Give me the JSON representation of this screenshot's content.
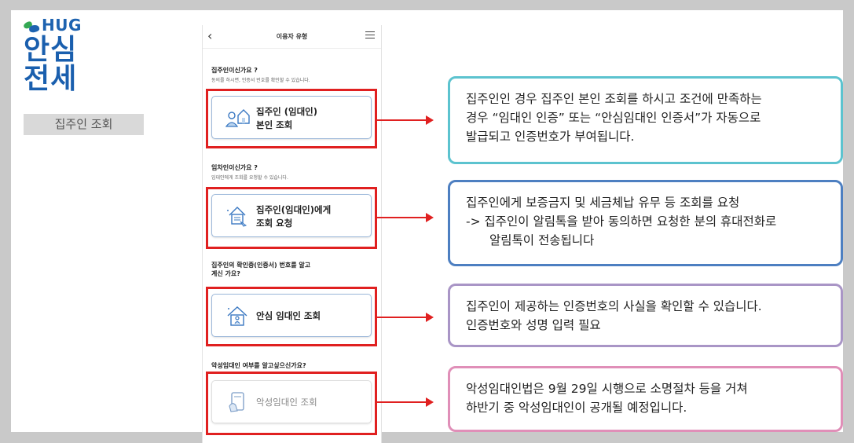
{
  "brand": {
    "logo_text": "HUG",
    "title_line1": "안심",
    "title_line2": "전세",
    "page_label": "집주인 조회"
  },
  "phone": {
    "header_title": "이용자 유형",
    "sections": [
      {
        "question": "집주인이신가요 ?",
        "sub": "동의를 하시면, 인증서 번호를 확인할 수 있습니다.",
        "card_line1": "집주인 (임대인)",
        "card_line2": "본인 조회",
        "icon": "house-person-icon"
      },
      {
        "question": "임차인이신가요 ?",
        "sub": "임대인에게 조회를 요청할 수 있습니다.",
        "card_line1": "집주인(임대인)에게",
        "card_line2": "조회 요청",
        "icon": "house-request-icon"
      },
      {
        "question_line1": "집주인의 확인증(인증서) 번호를 알고",
        "question_line2": "계신 가요?",
        "card_line1": "안심 임대인 조회",
        "icon": "house-safe-icon"
      },
      {
        "question": "악성임대인 여부를 알고싶으신가요?",
        "card_line1": "악성임대인 조회",
        "icon": "document-check-icon"
      }
    ]
  },
  "notes": [
    {
      "lines": [
        "집주인인 경우 집주인 본인 조회를 하시고 조건에 만족하는",
        "경우 “임대인 인증” 또는 “안심임대인 인증서”가 자동으로",
        "발급되고 인증번호가 부여됩니다."
      ],
      "color": "#5cc3cf"
    },
    {
      "lines": [
        "집주인에게 보증금지 및 세금체납 유무 등 조회를 요청",
        "-> 집주인이 알림톡을 받아 동의하면 요청한 분의 휴대전화로",
        "알림톡이 전송됩니다"
      ],
      "color": "#4d7fc1"
    },
    {
      "lines": [
        "집주인이 제공하는 인증번호의 사실을 확인할 수 있습니다.",
        "인증번호와 성명 입력 필요"
      ],
      "color": "#a995c6"
    },
    {
      "lines": [
        "악성임대인법은 9월 29일 시행으로 소명절차 등을 거쳐",
        "하반기 중 악성임대인이 공개될 예정입니다."
      ],
      "color": "#e08fb8"
    }
  ],
  "colors": {
    "highlight": "#e02020",
    "brand_blue": "#1e63b0"
  }
}
